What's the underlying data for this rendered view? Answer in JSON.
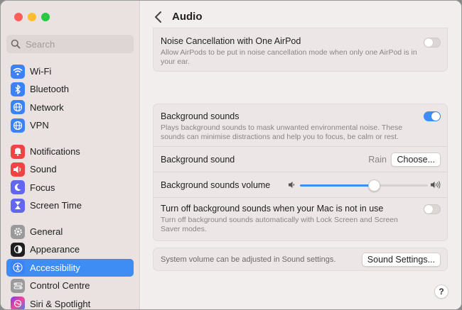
{
  "sidebar": {
    "search_placeholder": "Search",
    "groups": [
      [
        {
          "label": "Wi-Fi",
          "icon": "wifi-icon",
          "color": "#3b82f6"
        },
        {
          "label": "Bluetooth",
          "icon": "bluetooth-icon",
          "color": "#3b82f6"
        },
        {
          "label": "Network",
          "icon": "network-globe-icon",
          "color": "#3b82f6"
        },
        {
          "label": "VPN",
          "icon": "vpn-globe-icon",
          "color": "#3b82f6"
        }
      ],
      [
        {
          "label": "Notifications",
          "icon": "notifications-bell-icon",
          "color": "#ef4444"
        },
        {
          "label": "Sound",
          "icon": "sound-speaker-icon",
          "color": "#ef4444"
        },
        {
          "label": "Focus",
          "icon": "focus-moon-icon",
          "color": "#6366f1"
        },
        {
          "label": "Screen Time",
          "icon": "hourglass-icon",
          "color": "#6366f1"
        }
      ],
      [
        {
          "label": "General",
          "icon": "gear-icon",
          "color": "#9a9a9a"
        },
        {
          "label": "Appearance",
          "icon": "appearance-icon",
          "color": "#1f1f1f"
        },
        {
          "label": "Accessibility",
          "icon": "accessibility-icon",
          "color": "#3b82f6",
          "active": true
        },
        {
          "label": "Control Centre",
          "icon": "control-centre-icon",
          "color": "#9a9a9a"
        },
        {
          "label": "Siri & Spotlight",
          "icon": "siri-icon",
          "color": "#7c3aed"
        }
      ]
    ]
  },
  "header": {
    "title": "Audio"
  },
  "noise": {
    "title": "Noise Cancellation with One AirPod",
    "description": "Allow AirPods to be put in noise cancellation mode when only one AirPod is in your ear.",
    "enabled": false
  },
  "background": {
    "title": "Background sounds",
    "description": "Plays background sounds to mask unwanted environmental noise. These sounds can minimise distractions and help you to focus, be calm or rest.",
    "enabled": true,
    "sound_label": "Background sound",
    "sound_value": "Rain",
    "choose_button": "Choose...",
    "volume_label": "Background sounds volume",
    "volume_level": 0.58,
    "turnoff_title": "Turn off background sounds when your Mac is not in use",
    "turnoff_description": "Turn off background sounds automatically with Lock Screen and Screen Saver modes.",
    "turnoff_enabled": false
  },
  "footer": {
    "note": "System volume can be adjusted in Sound settings.",
    "button": "Sound Settings..."
  },
  "help_label": "?",
  "colors": {
    "accent": "#3d8df5"
  }
}
